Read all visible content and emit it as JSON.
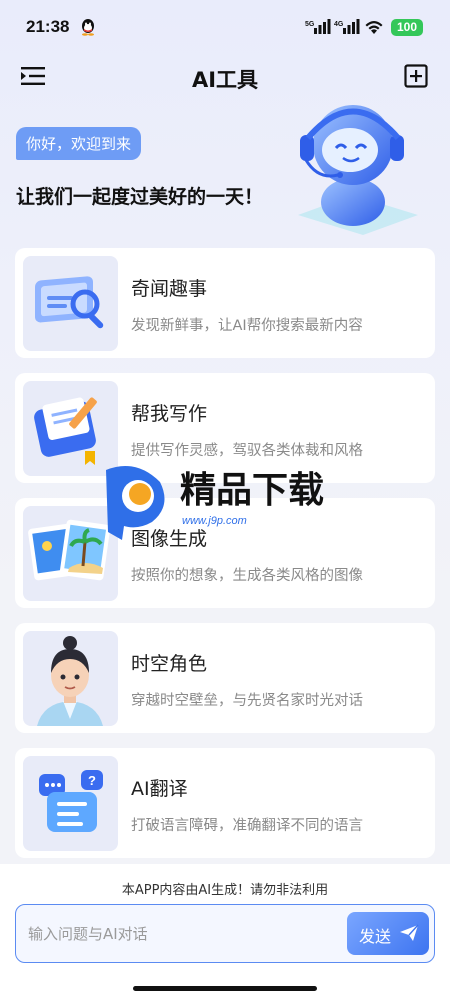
{
  "status_bar": {
    "time": "21:38",
    "net1": "5G",
    "net2": "4G",
    "battery": "100"
  },
  "nav": {
    "title": "AI工具"
  },
  "hero": {
    "greeting": "你好，欢迎到来",
    "tagline": "让我们一起度过美好的一天！"
  },
  "cards": [
    {
      "title": "奇闻趣事",
      "desc": "发现新鲜事，让AI帮你搜索最新内容"
    },
    {
      "title": "帮我写作",
      "desc": "提供写作灵感，驾驭各类体裁和风格"
    },
    {
      "title": "图像生成",
      "desc": "按照你的想象，生成各类风格的图像"
    },
    {
      "title": "时空角色",
      "desc": "穿越时空壁垒，与先贤名家时光对话"
    },
    {
      "title": "AI翻译",
      "desc": "打破语言障碍，准确翻译不同的语言"
    }
  ],
  "watermark": {
    "brand": "精品下载",
    "url": "www.j9p.com"
  },
  "footer": {
    "notice": "本APP内容由AI生成！请勿非法利用",
    "input_placeholder": "输入问题与AI对话",
    "send_label": "发送"
  },
  "colors": {
    "accent": "#4a7ff2",
    "battery": "#34c759"
  }
}
